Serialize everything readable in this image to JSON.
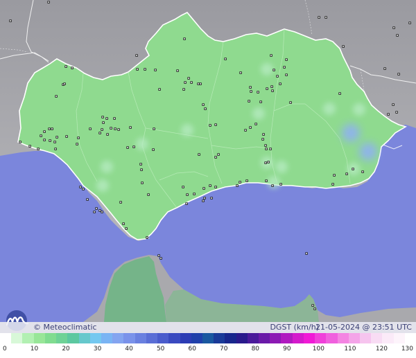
{
  "map": {
    "colors": {
      "sea": "#7b86dc",
      "land_outside": "#a9a9ad",
      "region_fill": "#8fda8f",
      "region_border": "#ffffff",
      "station_marker": "#222222",
      "gust_blue": "#8fb2ee"
    }
  },
  "footer": {
    "brand": "© Meteoclimatic",
    "parameter": "DGST (km/h)",
    "timestamp": "21-05-2024 @ 23:51 UTC"
  },
  "legend": {
    "labels": [
      "0",
      "10",
      "20",
      "30",
      "40",
      "50",
      "60",
      "70",
      "80",
      "90",
      "100",
      "110",
      "120",
      "130"
    ],
    "colors": [
      "#ffffff",
      "#d8f8d8",
      "#b2f0b2",
      "#98e698",
      "#80dc90",
      "#6ed296",
      "#5cc8a0",
      "#66c8cc",
      "#74c8f0",
      "#7ab4f4",
      "#84a4f0",
      "#7a92ea",
      "#6a80e0",
      "#5a6ed6",
      "#4a5ccc",
      "#3a4ac0",
      "#2c3cb4",
      "#2040aa",
      "#1a58a0",
      "#1a3a98",
      "#18268c",
      "#2a1a8c",
      "#4a1a9a",
      "#6a1aa8",
      "#8c1ab4",
      "#b01ac0",
      "#d41acc",
      "#f01ad6",
      "#f040da",
      "#f060de",
      "#f484e2",
      "#f4a4e8",
      "#f6c4ee",
      "#f8dcf4",
      "#fbeaf8",
      "#fdf4fb",
      "#ffffff"
    ]
  },
  "stations": [
    [
      70,
      3
    ],
    [
      15,
      30
    ],
    [
      460,
      25
    ],
    [
      470,
      25
    ],
    [
      568,
      40
    ],
    [
      573,
      51
    ],
    [
      591,
      33
    ],
    [
      495,
      67
    ],
    [
      266,
      56
    ],
    [
      197,
      80
    ],
    [
      95,
      96
    ],
    [
      104,
      98
    ],
    [
      198,
      100
    ],
    [
      209,
      100
    ],
    [
      224,
      101
    ],
    [
      325,
      85
    ],
    [
      391,
      80
    ],
    [
      413,
      86
    ],
    [
      395,
      101
    ],
    [
      410,
      97
    ],
    [
      400,
      110
    ],
    [
      413,
      108
    ],
    [
      347,
      105
    ],
    [
      256,
      102
    ],
    [
      267,
      119
    ],
    [
      272,
      113
    ],
    [
      276,
      119
    ],
    [
      265,
      129
    ],
    [
      286,
      121
    ],
    [
      289,
      121
    ],
    [
      230,
      129
    ],
    [
      81,
      139
    ],
    [
      91,
      122
    ],
    [
      93,
      121
    ],
    [
      361,
      126
    ],
    [
      362,
      132
    ],
    [
      372,
      133
    ],
    [
      392,
      125
    ],
    [
      393,
      131
    ],
    [
      359,
      146
    ],
    [
      376,
      147
    ],
    [
      385,
      128
    ],
    [
      404,
      121
    ],
    [
      490,
      135
    ],
    [
      555,
      99
    ],
    [
      575,
      107
    ],
    [
      567,
      151
    ],
    [
      572,
      162
    ],
    [
      560,
      165
    ],
    [
      293,
      151
    ],
    [
      296,
      157
    ],
    [
      419,
      148
    ],
    [
      148,
      169
    ],
    [
      154,
      171
    ],
    [
      165,
      171
    ],
    [
      160,
      185
    ],
    [
      147,
      187
    ],
    [
      155,
      194
    ],
    [
      144,
      192
    ],
    [
      166,
      186
    ],
    [
      171,
      187
    ],
    [
      149,
      177
    ],
    [
      130,
      186
    ],
    [
      188,
      184
    ],
    [
      222,
      186
    ],
    [
      75,
      186
    ],
    [
      64,
      190
    ],
    [
      59,
      196
    ],
    [
      64,
      202
    ],
    [
      72,
      203
    ],
    [
      82,
      198
    ],
    [
      71,
      186
    ],
    [
      79,
      205
    ],
    [
      80,
      215
    ],
    [
      96,
      197
    ],
    [
      111,
      208
    ],
    [
      113,
      199
    ],
    [
      43,
      211
    ],
    [
      55,
      215
    ],
    [
      29,
      205
    ],
    [
      184,
      213
    ],
    [
      193,
      212
    ],
    [
      221,
      216
    ],
    [
      303,
      181
    ],
    [
      311,
      180
    ],
    [
      361,
      184
    ],
    [
      369,
      179
    ],
    [
      354,
      188
    ],
    [
      380,
      194
    ],
    [
      379,
      201
    ],
    [
      383,
      210
    ],
    [
      384,
      215
    ],
    [
      390,
      215
    ],
    [
      287,
      223
    ],
    [
      311,
      227
    ],
    [
      315,
      223
    ],
    [
      383,
      235
    ],
    [
      387,
      234
    ],
    [
      203,
      237
    ],
    [
      204,
      245
    ],
    [
      214,
      281
    ],
    [
      205,
      264
    ],
    [
      116,
      270
    ],
    [
      120,
      273
    ],
    [
      126,
      288
    ],
    [
      136,
      306
    ],
    [
      147,
      306
    ],
    [
      139,
      301
    ],
    [
      144,
      304
    ],
    [
      174,
      292
    ],
    [
      178,
      323
    ],
    [
      212,
      343
    ],
    [
      182,
      330
    ],
    [
      264,
      270
    ],
    [
      270,
      281
    ],
    [
      280,
      280
    ],
    [
      269,
      294
    ],
    [
      294,
      272
    ],
    [
      303,
      268
    ],
    [
      311,
      270
    ],
    [
      295,
      286
    ],
    [
      305,
      286
    ],
    [
      293,
      290
    ],
    [
      342,
      268
    ],
    [
      346,
      263
    ],
    [
      356,
      261
    ],
    [
      384,
      261
    ],
    [
      393,
      268
    ],
    [
      405,
      266
    ],
    [
      480,
      266
    ],
    [
      482,
      253
    ],
    [
      500,
      251
    ],
    [
      509,
      244
    ],
    [
      523,
      248
    ],
    [
      442,
      366
    ],
    [
      229,
      369
    ],
    [
      232,
      373
    ],
    [
      451,
      441
    ],
    [
      454,
      446
    ]
  ],
  "lighter_spots": [
    [
      154,
      241
    ],
    [
      148,
      268
    ],
    [
      205,
      208
    ],
    [
      270,
      188
    ],
    [
      385,
      100
    ],
    [
      475,
      157
    ],
    [
      518,
      158
    ],
    [
      510,
      244
    ],
    [
      406,
      241
    ],
    [
      395,
      263
    ],
    [
      385,
      235
    ],
    [
      373,
      164
    ]
  ],
  "gust_spots": [
    [
      506,
      192
    ],
    [
      531,
      219
    ]
  ]
}
